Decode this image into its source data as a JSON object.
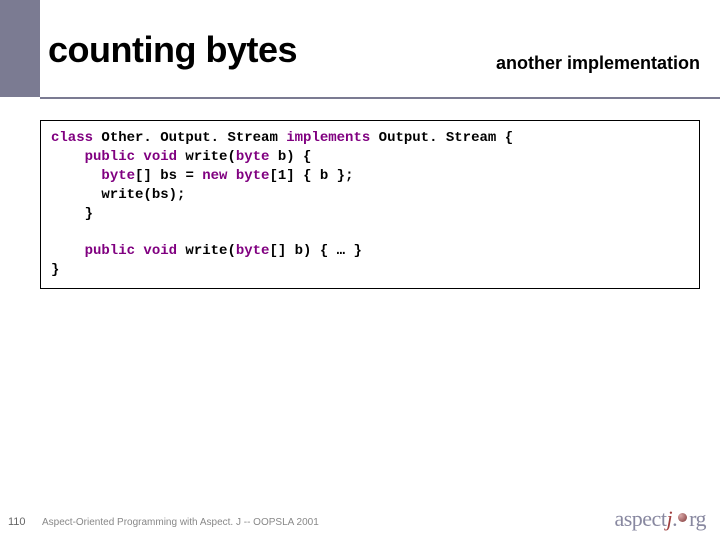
{
  "header": {
    "title": "counting bytes",
    "subtitle": "another implementation"
  },
  "code": {
    "l1a": "class",
    "l1b": " Other. Output. Stream ",
    "l1c": "implements",
    "l1d": " Output. Stream {",
    "l2a": "    public void",
    "l2b": " write(",
    "l2c": "byte",
    "l2d": " b) {",
    "l3a": "      ",
    "l3b": "byte",
    "l3c": "[] bs = ",
    "l3d": "new byte",
    "l3e": "[1] { b };",
    "l4": "      write(bs);",
    "l5": "    }",
    "blank": "",
    "l6a": "    public void",
    "l6b": " write(",
    "l6c": "byte",
    "l6d": "[] b) { … }",
    "l7": "}"
  },
  "footer": {
    "page": "110",
    "text": "Aspect-Oriented Programming with Aspect. J -- OOPSLA 2001",
    "logo_a": "aspect",
    "logo_j": "j",
    "logo_rest": "rg"
  }
}
